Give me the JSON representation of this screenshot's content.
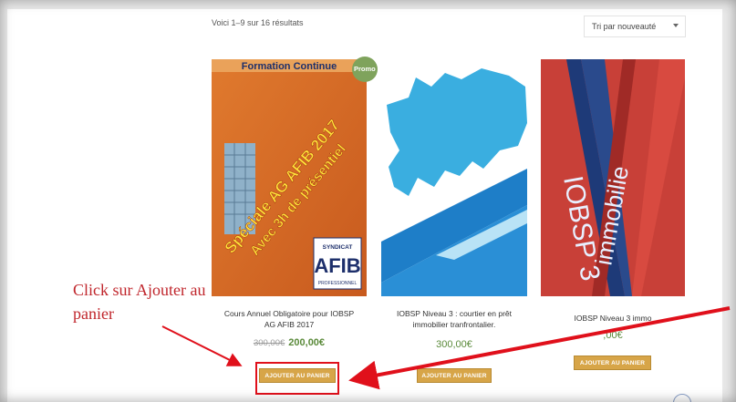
{
  "shop": {
    "results_text": "Voici 1–9 sur 16 résultats",
    "sort_selected": "Tri par nouveauté"
  },
  "products": [
    {
      "title": "Cours Annuel Obligatoire pour IOBSP AG AFIB 2017",
      "price_old": "300,00€",
      "price_new": "200,00€",
      "button": "AJOUTER AU PANIER",
      "badge": "Promo !",
      "image_banner": "Formation Continue",
      "image_text_line1": "Spéciale AG AFIB 2017",
      "image_text_line2": "Avec 3h de présentiel",
      "logo_top": "SYNDICAT",
      "logo_main": "AFIB",
      "logo_bottom": "PROFESSIONNEL"
    },
    {
      "title": "IOBSP Niveau 3 : courtier en prêt immobilier tranfrontalier.",
      "price": "300,00€",
      "button": "AJOUTER AU PANIER"
    },
    {
      "title": "IOBSP Niveau 3 immo",
      "price_visible": ",00€",
      "button": "AJOUTER AU PANIER",
      "image_text_1": "IOBSP 3",
      "image_text_2": "immobilie"
    }
  ],
  "annotation": {
    "text": "Click sur Ajouter au panier",
    "color": "#c0262c"
  },
  "colors": {
    "button": "#d7a548",
    "price": "#5a8a3a",
    "promo": "#7fa35c",
    "highlight": "#e0101b"
  }
}
